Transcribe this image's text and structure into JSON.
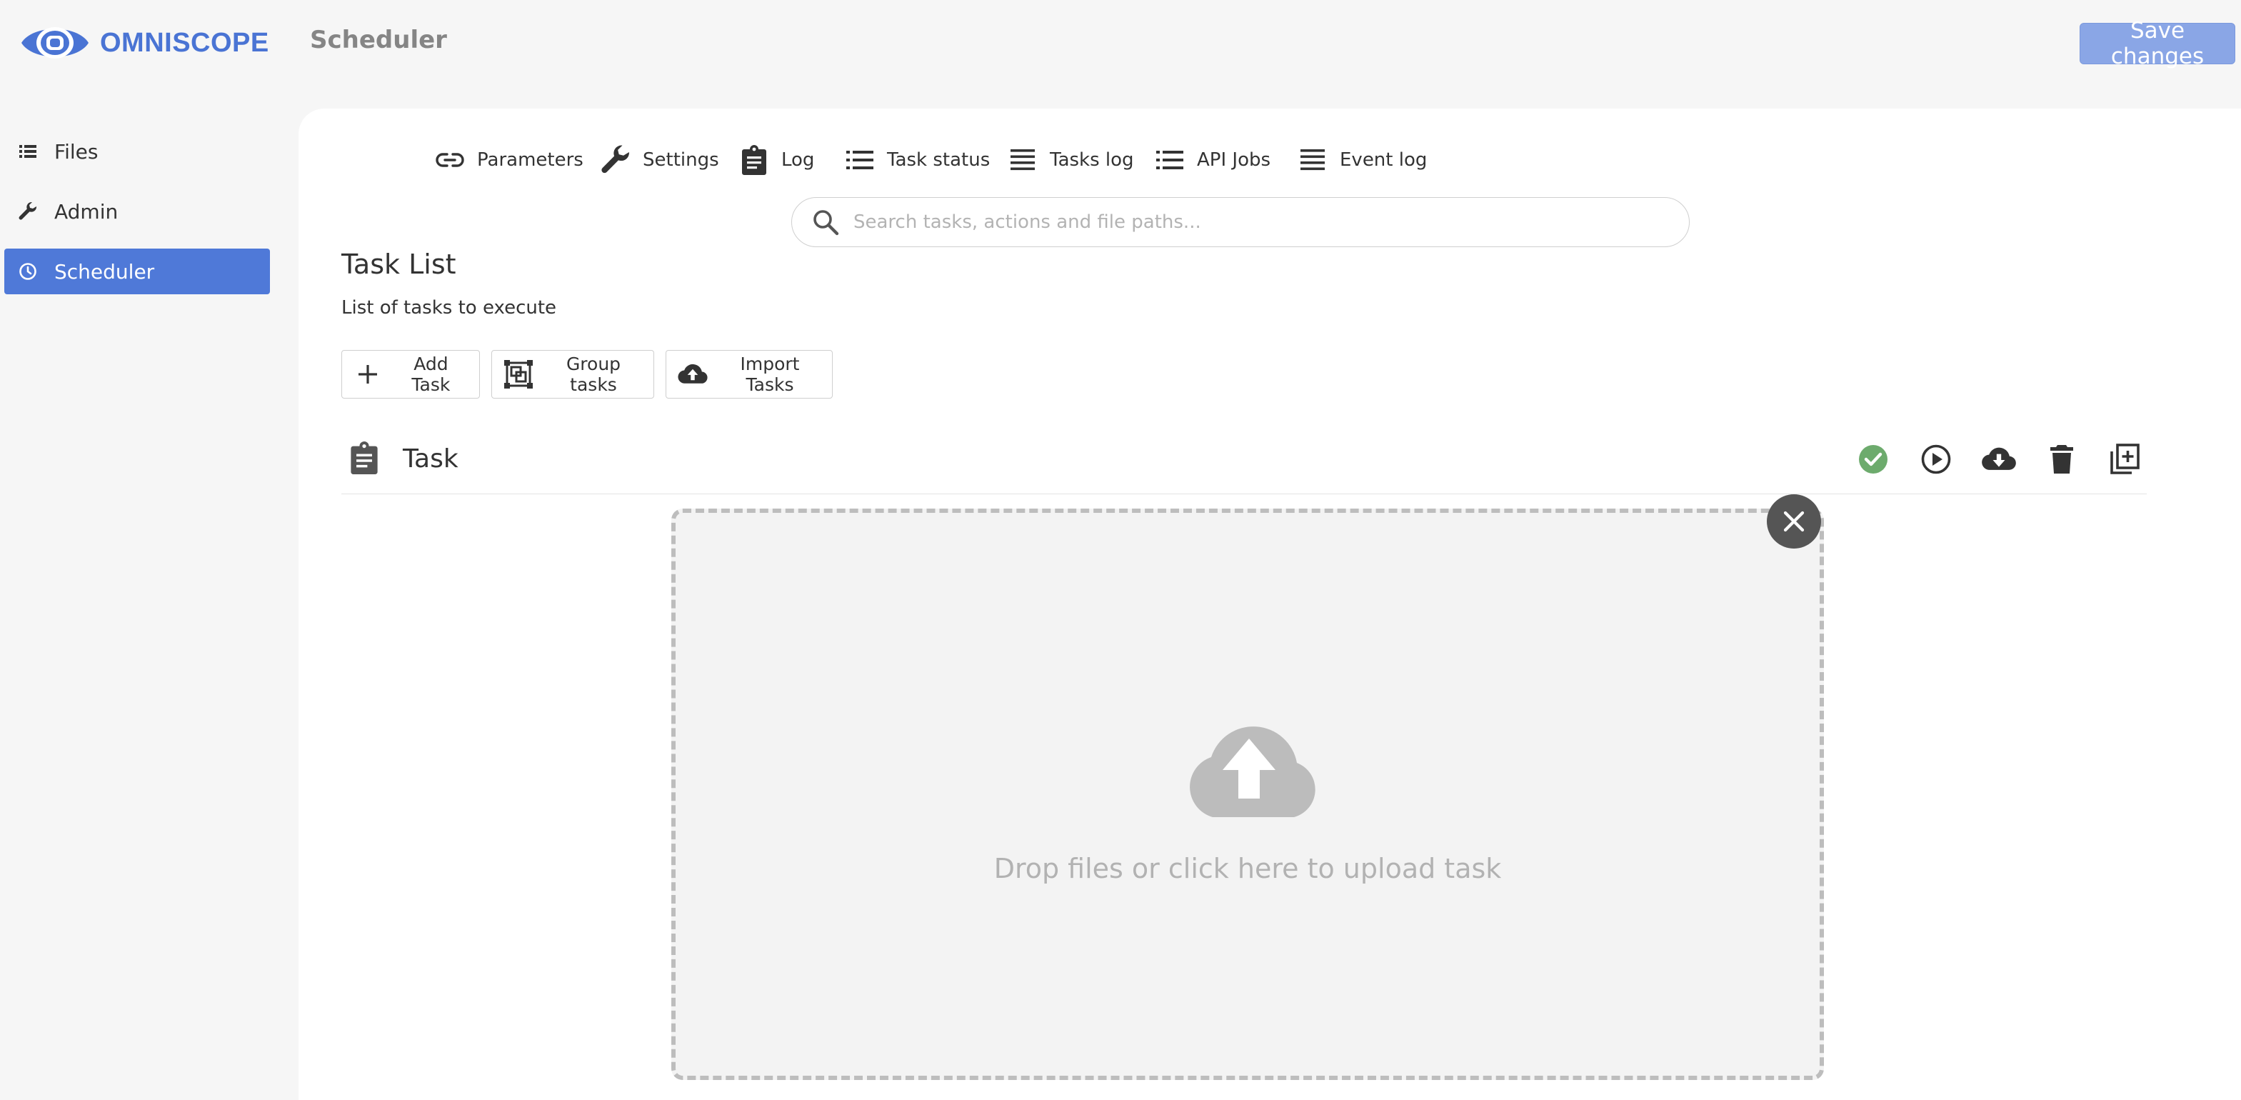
{
  "header": {
    "logo_text": "OMNISCOPE",
    "page_title": "Scheduler",
    "save_label": "Save changes"
  },
  "sidebar": {
    "items": [
      {
        "label": "Files",
        "icon": "list-icon"
      },
      {
        "label": "Admin",
        "icon": "wrench-icon"
      },
      {
        "label": "Scheduler",
        "icon": "clock-icon",
        "active": true
      }
    ]
  },
  "topnav": {
    "items": [
      {
        "label": "Parameters",
        "icon": "link-icon"
      },
      {
        "label": "Settings",
        "icon": "wrench-icon"
      },
      {
        "label": "Log",
        "icon": "clipboard-icon"
      },
      {
        "label": "Task status",
        "icon": "list-icon"
      },
      {
        "label": "Tasks log",
        "icon": "lines-icon"
      },
      {
        "label": "API Jobs",
        "icon": "list-icon"
      },
      {
        "label": "Event log",
        "icon": "lines-icon"
      }
    ]
  },
  "search": {
    "placeholder": "Search tasks, actions and file paths...",
    "value": ""
  },
  "tasklist": {
    "title": "Task List",
    "subtitle": "List of tasks to execute",
    "buttons": {
      "add": "Add Task",
      "group": "Group tasks",
      "import": "Import Tasks"
    }
  },
  "task": {
    "label": "Task",
    "actions": [
      "check-circle-icon",
      "play-circle-icon",
      "cloud-download-icon",
      "trash-icon",
      "copy-add-icon"
    ]
  },
  "dropzone": {
    "text": "Drop files or click here to upload task"
  },
  "colors": {
    "accent": "#4f79d8",
    "save_button": "#8aa6e6",
    "success": "#6dab6d",
    "logo": "#4a74d4"
  }
}
